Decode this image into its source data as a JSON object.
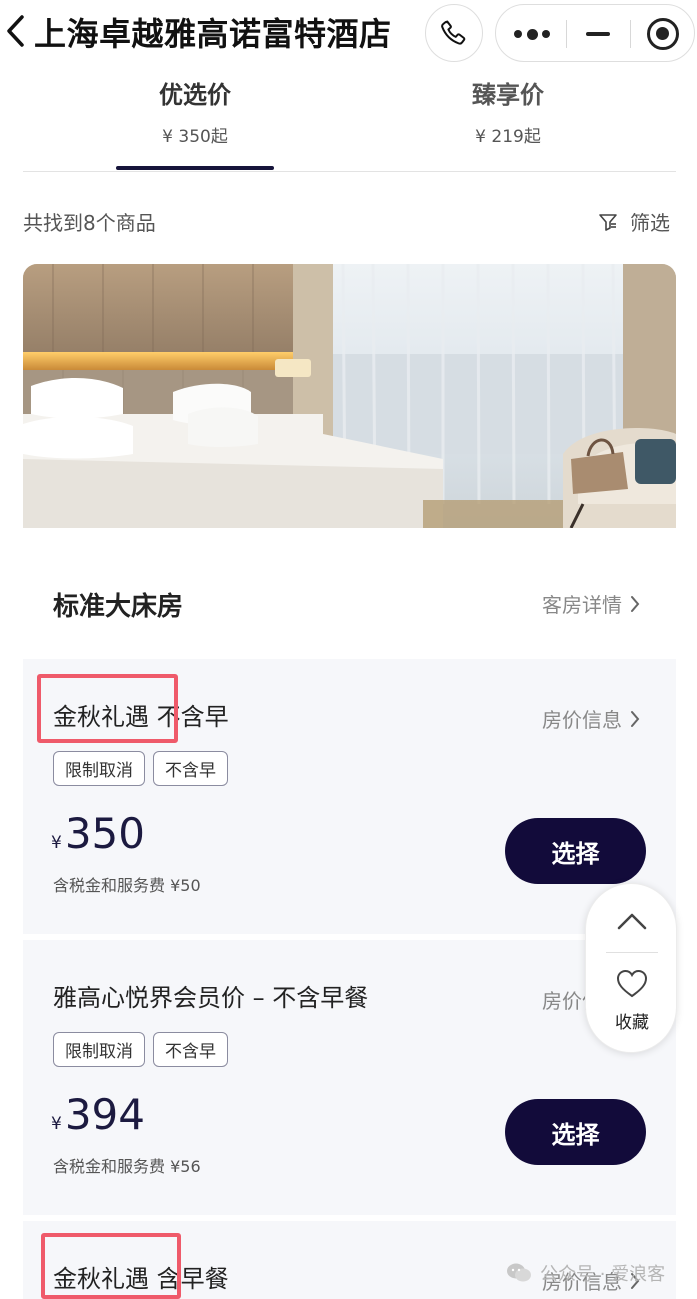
{
  "header": {
    "title": "上海卓越雅高诺富特酒店"
  },
  "tabs": [
    {
      "label": "优选价",
      "price": "¥ 350起"
    },
    {
      "label": "臻享价",
      "price": "¥ 219起"
    }
  ],
  "results": {
    "count_text": "共找到8个商品",
    "filter_label": "筛选"
  },
  "room": {
    "title": "标准大床房",
    "detail_link": "客房详情"
  },
  "rates": [
    {
      "name": "金秋礼遇 不含早",
      "info_link": "房价信息",
      "tags": [
        "限制取消",
        "不含早"
      ],
      "currency": "¥",
      "price": "350",
      "tax_note": "含税金和服务费 ¥50",
      "select_label": "选择"
    },
    {
      "name": "雅高心悦界会员价 – 不含早餐",
      "info_link": "房价信息",
      "tags": [
        "限制取消",
        "不含早"
      ],
      "currency": "¥",
      "price": "394",
      "tax_note": "含税金和服务费 ¥56",
      "select_label": "选择"
    },
    {
      "name": "金秋礼遇 含早餐",
      "info_link": "房价信息"
    }
  ],
  "float_panel": {
    "favorite_label": "收藏"
  },
  "watermark": {
    "text": "公众号 · 爱浪客"
  },
  "colors": {
    "primary_button": "#120b3a",
    "tab_indicator": "#16143a",
    "highlight_box": "#ef5a6a",
    "rate_background": "#f6f7fa"
  }
}
